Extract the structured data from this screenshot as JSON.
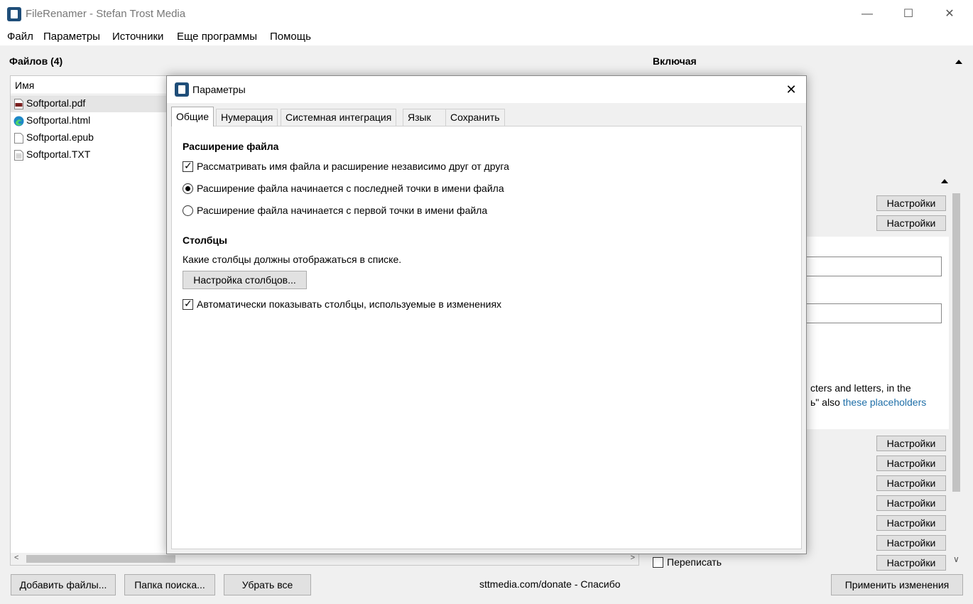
{
  "window": {
    "title": "FileRenamer - Stefan Trost Media",
    "minimize": "—",
    "maximize": "☐",
    "close": "✕"
  },
  "menu": [
    "Файл",
    "Параметры",
    "Источники",
    "Еще программы",
    "Помощь"
  ],
  "files": {
    "title": "Файлов (4)",
    "column": "Имя",
    "items": [
      {
        "name": "Softportal.pdf",
        "icon": "pdf-file-icon",
        "selected": true
      },
      {
        "name": "Softportal.html",
        "icon": "edge-browser-icon",
        "selected": false
      },
      {
        "name": "Softportal.epub",
        "icon": "blank-file-icon",
        "selected": false
      },
      {
        "name": "Softportal.TXT",
        "icon": "text-file-icon",
        "selected": false
      }
    ]
  },
  "right_panel": {
    "title": "Включая",
    "settings_label": "Настройки",
    "text_line1": "cters and letters, in the",
    "text_line2_prefix": "ь\" also ",
    "text_line2_link": "these placeholders",
    "overwrite_label": "Переписать"
  },
  "bottom": {
    "add_files": "Добавить файлы...",
    "search_folder": "Папка поиска...",
    "remove_all": "Убрать все",
    "donate": "sttmedia.com/donate - Спасибо",
    "apply": "Применить изменения"
  },
  "dialog": {
    "title": "Параметры",
    "close": "✕",
    "tabs": [
      "Общие",
      "Нумерация",
      "Системная интеграция",
      "Язык",
      "Сохранить"
    ],
    "active_tab": "Общие",
    "ext_section_title": "Расширение файла",
    "opt_independent": "Рассматривать имя файла и расширение независимо друг от друга",
    "opt_independent_checked": true,
    "opt_last_dot": "Расширение файла начинается с последней точки в имени файла",
    "opt_last_dot_selected": true,
    "opt_first_dot": "Расширение файла начинается с первой точки в имени файла",
    "opt_first_dot_selected": false,
    "cols_section_title": "Столбцы",
    "cols_question": "Какие столбцы должны отображаться в списке.",
    "cols_button": "Настройка столбцов...",
    "auto_cols": "Автоматически показывать столбцы, используемые в изменениях",
    "auto_cols_checked": true
  },
  "colors": {
    "accent": "#1f4e79",
    "link": "#1f6fa8",
    "selection": "#e5e5e5"
  }
}
